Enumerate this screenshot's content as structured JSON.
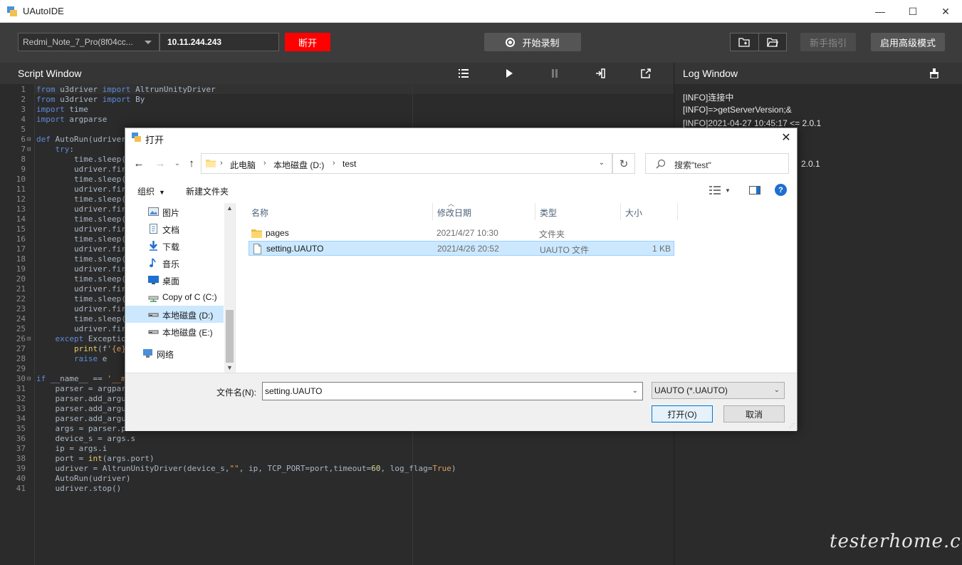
{
  "window": {
    "title": "UAutoIDE",
    "controls": [
      "—",
      "☐",
      "✕"
    ]
  },
  "toolbar": {
    "device": "Redmi_Note_7_Pro(8f04cc...",
    "ip": "10.11.244.243",
    "disconnect_label": "断开",
    "record_label": "开始录制",
    "guide_label": "新手指引",
    "advanced_label": "启用高级模式",
    "colors": {
      "disconnect": "#ff0000",
      "background": "#3c3c3c"
    }
  },
  "script_panel": {
    "title": "Script Window",
    "icons": [
      "list-icon",
      "play-icon",
      "pause-icon",
      "export-icon",
      "open-external-icon"
    ]
  },
  "log_panel": {
    "title": "Log Window",
    "lines": [
      "[INFO]连接中",
      "[INFO]=>getServerVersion;&",
      "[INFO]2021-04-27 10:45:17 <= 2.0.1",
      "2.0.1"
    ]
  },
  "editor": {
    "lines": [
      "from u3driver import AltrunUnityDriver",
      "from u3driver import By",
      "import time",
      "import argparse",
      "",
      "def AutoRun(udriver",
      "    try:",
      "        time.sleep(",
      "        udriver.fir",
      "        time.sleep(",
      "        udriver.fir",
      "        time.sleep(",
      "        udriver.fir",
      "        time.sleep(",
      "        udriver.fir",
      "        time.sleep(",
      "        udriver.fir",
      "        time.sleep(",
      "        udriver.fir",
      "        time.sleep(",
      "        udriver.fir",
      "        time.sleep(",
      "        udriver.fir",
      "        time.sleep(",
      "        udriver.fir",
      "    except Exception",
      "        print(f'{e}",
      "        raise e",
      "",
      "if __name__ == '__m",
      "    parser = argpar",
      "    parser.add_argu",
      "    parser.add_argu",
      "    parser.add_argu",
      "    args = parser.p",
      "    device_s = args.s",
      "    ip = args.i",
      "    port = int(args.port)",
      "    udriver = AltrunUnityDriver(device_s,\"\", ip, TCP_PORT=port,timeout=60, log_flag=True)",
      "    AutoRun(udriver)",
      "    udriver.stop()"
    ]
  },
  "dialog": {
    "title": "打开",
    "breadcrumb": [
      "此电脑",
      "本地磁盘 (D:)",
      "test"
    ],
    "search_placeholder": "搜索\"test\"",
    "organize_label": "组织",
    "new_folder_label": "新建文件夹",
    "nav_items": [
      {
        "label": "图片",
        "icon": "pictures-icon"
      },
      {
        "label": "文档",
        "icon": "documents-icon"
      },
      {
        "label": "下载",
        "icon": "downloads-icon"
      },
      {
        "label": "音乐",
        "icon": "music-icon"
      },
      {
        "label": "桌面",
        "icon": "desktop-icon"
      },
      {
        "label": "Copy of C (C:)",
        "icon": "network-drive-icon"
      },
      {
        "label": "本地磁盘 (D:)",
        "icon": "drive-icon"
      },
      {
        "label": "本地磁盘 (E:)",
        "icon": "drive-icon"
      },
      {
        "label": "网络",
        "icon": "network-icon"
      }
    ],
    "columns": [
      "名称",
      "修改日期",
      "类型",
      "大小"
    ],
    "files": [
      {
        "name": "pages",
        "date": "2021/4/27 10:30",
        "type": "文件夹",
        "size": "",
        "icon": "folder-icon"
      },
      {
        "name": "setting.UAUTO",
        "date": "2021/4/26 20:52",
        "type": "UAUTO 文件",
        "size": "1 KB",
        "icon": "file-icon"
      }
    ],
    "filename_label": "文件名(N):",
    "filename_value": "setting.UAUTO",
    "filetype_value": "UAUTO (*.UAUTO)",
    "open_label": "打开(O)",
    "cancel_label": "取消"
  },
  "watermark": "testerhome.com"
}
